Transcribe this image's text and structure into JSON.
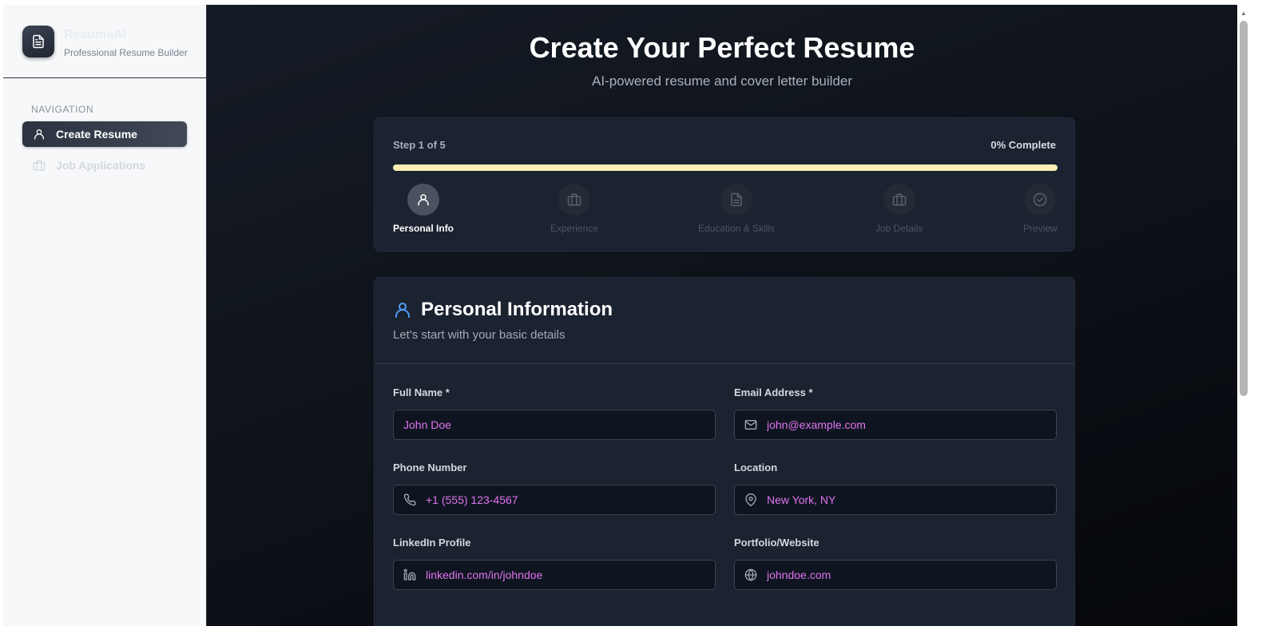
{
  "sidebar": {
    "brand_title": "ResumeAI",
    "brand_subtitle": "Professional Resume Builder",
    "nav_heading": "NAVIGATION",
    "items": [
      {
        "label": "Create Resume",
        "icon": "user-icon",
        "active": true
      },
      {
        "label": "Job Applications",
        "icon": "briefcase-icon",
        "active": false
      }
    ]
  },
  "header": {
    "title": "Create Your Perfect Resume",
    "subtitle": "AI-powered resume and cover letter builder"
  },
  "progress": {
    "step_text": "Step 1 of 5",
    "percent_text": "0% Complete",
    "percent_value": 0,
    "steps": [
      {
        "label": "Personal Info",
        "icon": "user-icon",
        "current": true
      },
      {
        "label": "Experience",
        "icon": "briefcase-icon",
        "current": false
      },
      {
        "label": "Education & Skills",
        "icon": "document-icon",
        "current": false
      },
      {
        "label": "Job Details",
        "icon": "briefcase-icon",
        "current": false
      },
      {
        "label": "Preview",
        "icon": "check-circle-icon",
        "current": false
      }
    ]
  },
  "form": {
    "title": "Personal Information",
    "subtitle": "Let's start with your basic details",
    "fields": {
      "full_name": {
        "label": "Full Name *",
        "placeholder": "John Doe"
      },
      "email": {
        "label": "Email Address *",
        "placeholder": "john@example.com",
        "icon": "mail-icon"
      },
      "phone": {
        "label": "Phone Number",
        "placeholder": "+1 (555) 123-4567",
        "icon": "phone-icon"
      },
      "location": {
        "label": "Location",
        "placeholder": "New York, NY",
        "icon": "map-pin-icon"
      },
      "linkedin": {
        "label": "LinkedIn Profile",
        "placeholder": "linkedin.com/in/johndoe",
        "icon": "linkedin-icon"
      },
      "website": {
        "label": "Portfolio/Website",
        "placeholder": "johndoe.com",
        "icon": "globe-icon"
      }
    }
  },
  "colors": {
    "accent_text": "#e073f0",
    "progress_track": "#fbefb3",
    "person_icon": "#4f9cf5"
  }
}
